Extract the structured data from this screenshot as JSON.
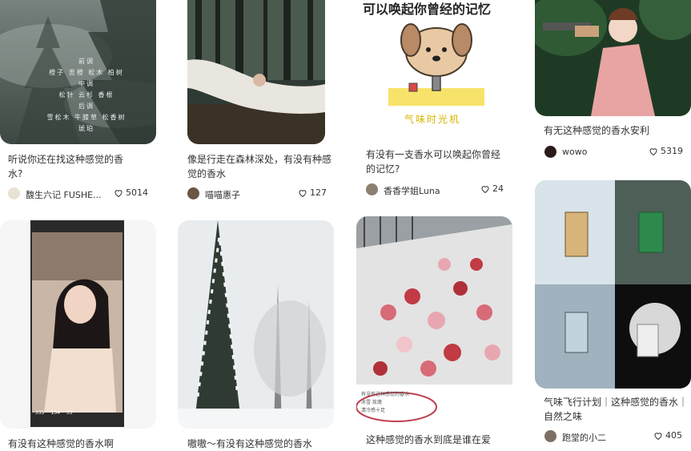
{
  "feed": [
    {
      "title": "听说你还在找这种感觉的香水?",
      "author": "馥生六记 FUSHE...",
      "likes": "5014",
      "cover_text": [
        "前调",
        "橙子 苦橙 松木 柏树",
        "中调",
        "松针 云杉 香根",
        "后调",
        "雪松木 牛膝草 松香树 琥珀"
      ]
    },
    {
      "title": "像是行走在森林深处，有没有种感觉的香水",
      "author": "喵喵惠子",
      "likes": "127"
    },
    {
      "title": "有没有一支香水可以唤起你曾经的记忆?",
      "author": "香香学姐Luna",
      "likes": "24",
      "cover_heading": "可以唤起你曾经的记忆",
      "cover_caption": "气味时光机"
    },
    {
      "title": "有无这种感觉的香水安利",
      "author": "wowo",
      "likes": "5319"
    },
    {
      "title": "有没有这种感觉的香水啊",
      "author": "",
      "likes": "",
      "video_stats": [
        "335",
        "134",
        "33"
      ]
    },
    {
      "title": "嗷嗷～有没有这种感觉的香水",
      "author": "",
      "likes": ""
    },
    {
      "title": "这种感觉的香水到底是谁在爱",
      "author": "",
      "likes": "",
      "cover_note": [
        "有没有这种感觉的香水",
        "冰雪 玫瑰",
        "清冷感十足"
      ]
    },
    {
      "title": "气味飞行计划｜这种感觉的香水｜自然之味",
      "author": "跑堂的小二",
      "likes": "405"
    }
  ],
  "colors": {
    "text": "#333333",
    "muted": "#666666",
    "background": "#ffffff"
  },
  "icons": {
    "like": "heart-outline-icon"
  }
}
